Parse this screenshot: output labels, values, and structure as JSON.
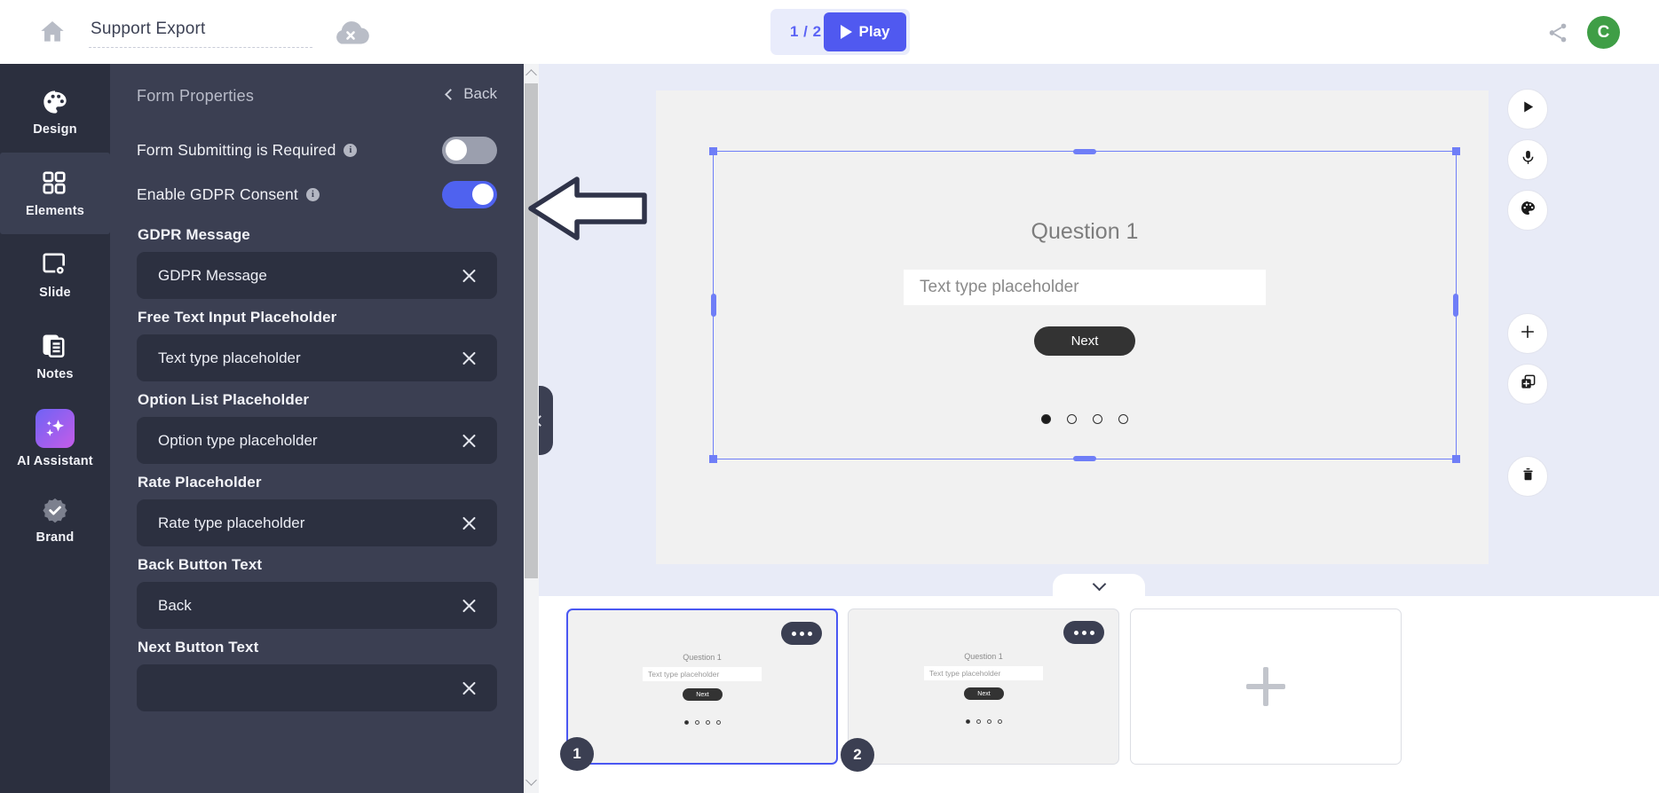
{
  "topbar": {
    "home_icon": "home-icon",
    "document_title": "Support Export",
    "document_title_placeholder": "Untitled",
    "cloud_status_icon": "cloud-offline-icon",
    "page_indicator": "1 / 2",
    "play_label": "Play",
    "share_icon": "share-icon",
    "avatar_initial": "C",
    "accent_color": "#5059f0",
    "avatar_color": "#3f9e46"
  },
  "rail": {
    "items": [
      {
        "label": "Design",
        "icon": "palette-icon",
        "active": false
      },
      {
        "label": "Elements",
        "icon": "grid-icon",
        "active": true
      },
      {
        "label": "Slide",
        "icon": "slide-gear-icon",
        "active": false
      },
      {
        "label": "Notes",
        "icon": "notes-icon",
        "active": false
      },
      {
        "label": "AI Assistant",
        "icon": "sparkles-icon",
        "active": false
      },
      {
        "label": "Brand",
        "icon": "badge-check-icon",
        "active": false
      }
    ]
  },
  "panel": {
    "title": "Form Properties",
    "back_label": "Back",
    "toggles": [
      {
        "label": "Form Submitting is Required",
        "info": "i",
        "on": false
      },
      {
        "label": "Enable GDPR Consent",
        "info": "i",
        "on": true
      }
    ],
    "fields": [
      {
        "label": "GDPR Message",
        "value": "GDPR Message"
      },
      {
        "label": "Free Text Input Placeholder",
        "value": "Text type placeholder"
      },
      {
        "label": "Option List Placeholder",
        "value": "Option type placeholder"
      },
      {
        "label": "Rate Placeholder",
        "value": "Rate type placeholder"
      },
      {
        "label": "Back Button Text",
        "value": "Back"
      },
      {
        "label": "Next Button Text",
        "value": ""
      }
    ]
  },
  "canvas": {
    "question_title": "Question 1",
    "input_placeholder": "Text type placeholder",
    "next_label": "Next",
    "dots_total": 4,
    "dots_active_index": 0,
    "selection_color": "#6f7ef7"
  },
  "tools": [
    {
      "name": "play-icon"
    },
    {
      "name": "microphone-icon"
    },
    {
      "name": "palette-icon"
    },
    {
      "name": "add-icon"
    },
    {
      "name": "duplicate-icon"
    },
    {
      "name": "trash-icon"
    }
  ],
  "filmstrip": {
    "slides": [
      {
        "number": "1",
        "selected": true,
        "question_title": "Question 1",
        "input_placeholder": "Text type placeholder",
        "next_label": "Next"
      },
      {
        "number": "2",
        "selected": false,
        "question_title": "Question 1",
        "input_placeholder": "Text type placeholder",
        "next_label": "Next"
      }
    ],
    "add_slide_icon": "plus-icon"
  },
  "annotation": {
    "arrow_icon": "left-arrow-annotation",
    "arrow_color": "#2f3349"
  }
}
